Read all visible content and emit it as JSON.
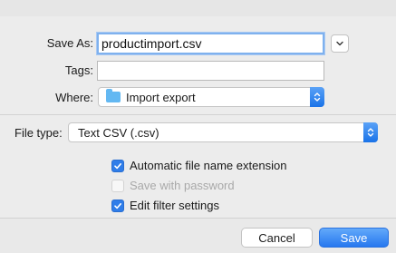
{
  "form": {
    "save_as_label": "Save As:",
    "save_as_value": "productimport.csv",
    "tags_label": "Tags:",
    "tags_value": "",
    "where_label": "Where:",
    "where_value": "Import export",
    "expand_icon": "chevron-down-icon",
    "folder_icon": "folder-icon"
  },
  "options": {
    "file_type_label": "File type:",
    "file_type_value": "Text CSV (.csv)",
    "checkboxes": [
      {
        "label": "Automatic file name extension",
        "checked": true,
        "enabled": true
      },
      {
        "label": "Save with password",
        "checked": false,
        "enabled": false
      },
      {
        "label": "Edit filter settings",
        "checked": true,
        "enabled": true
      }
    ]
  },
  "buttons": {
    "cancel": "Cancel",
    "save": "Save"
  },
  "colors": {
    "accent": "#2f7de9",
    "background": "#ececec",
    "disabled_text": "#a9a9a9"
  }
}
